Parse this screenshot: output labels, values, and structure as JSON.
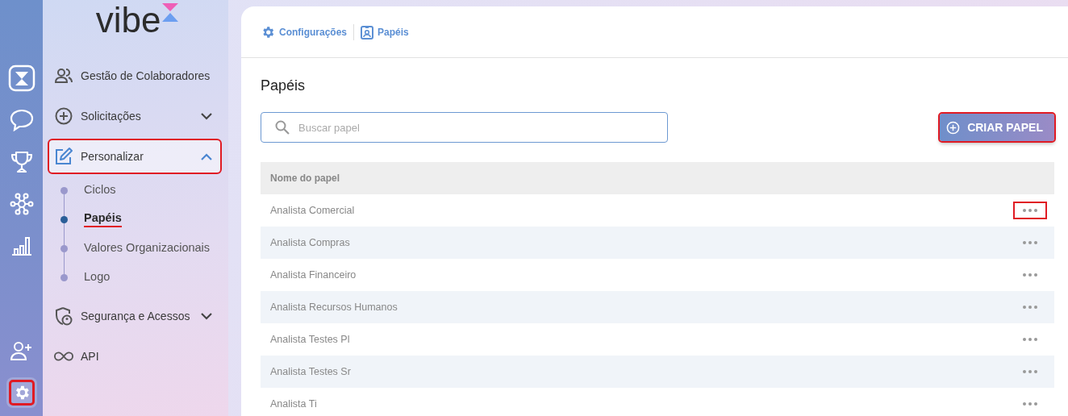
{
  "logo": {
    "text": "vibe"
  },
  "rail": [
    {
      "kind": "app",
      "selected": false,
      "annotated": false
    },
    {
      "kind": "chat",
      "selected": false,
      "annotated": false
    },
    {
      "kind": "trophy",
      "selected": false,
      "annotated": false
    },
    {
      "kind": "network",
      "selected": false,
      "annotated": false
    },
    {
      "kind": "chart",
      "selected": false,
      "annotated": false
    },
    {
      "kind": "spacer"
    },
    {
      "kind": "add-user",
      "selected": false,
      "annotated": false
    },
    {
      "kind": "settings",
      "selected": true,
      "annotated": true
    }
  ],
  "nav": [
    {
      "kind": "people",
      "label": "Gestão de Colaboradores",
      "selected": false,
      "annotated": false
    },
    {
      "kind": "plus",
      "label": "Solicitações",
      "expanded": false,
      "selected": false,
      "annotated": false
    },
    {
      "kind": "edit",
      "label": "Personalizar",
      "expanded": true,
      "selected": true,
      "annotated": true,
      "children": [
        {
          "label": "Ciclos",
          "selected": false,
          "annotated": false
        },
        {
          "label": "Papéis",
          "selected": true,
          "annotated": true
        },
        {
          "label": "Valores Organizacionais",
          "selected": false,
          "annotated": false
        },
        {
          "label": "Logo",
          "selected": false,
          "annotated": false
        }
      ]
    },
    {
      "kind": "shield",
      "label": "Segurança e Acessos",
      "expanded": false,
      "selected": false,
      "annotated": false
    },
    {
      "kind": "infinity",
      "label": "API",
      "selected": false,
      "annotated": false
    }
  ],
  "breadcrumb": [
    {
      "kind": "settings",
      "label": "Configurações"
    },
    {
      "kind": "badge",
      "label": "Papéis"
    }
  ],
  "page_title": "Papéis",
  "search": {
    "placeholder": "Buscar papel"
  },
  "create_button": {
    "label": "CRIAR PAPEL",
    "annotated": true
  },
  "table": {
    "columns": [
      "Nome do papel"
    ],
    "rows": [
      {
        "name": "Analista Comercial",
        "annotated": true
      },
      {
        "name": "Analista Compras",
        "annotated": false
      },
      {
        "name": "Analista Financeiro",
        "annotated": false
      },
      {
        "name": "Analista Recursos Humanos",
        "annotated": false
      },
      {
        "name": "Analista Testes Pl",
        "annotated": false
      },
      {
        "name": "Analista Testes Sr",
        "annotated": false
      },
      {
        "name": "Analista Ti",
        "annotated": false
      }
    ]
  }
}
